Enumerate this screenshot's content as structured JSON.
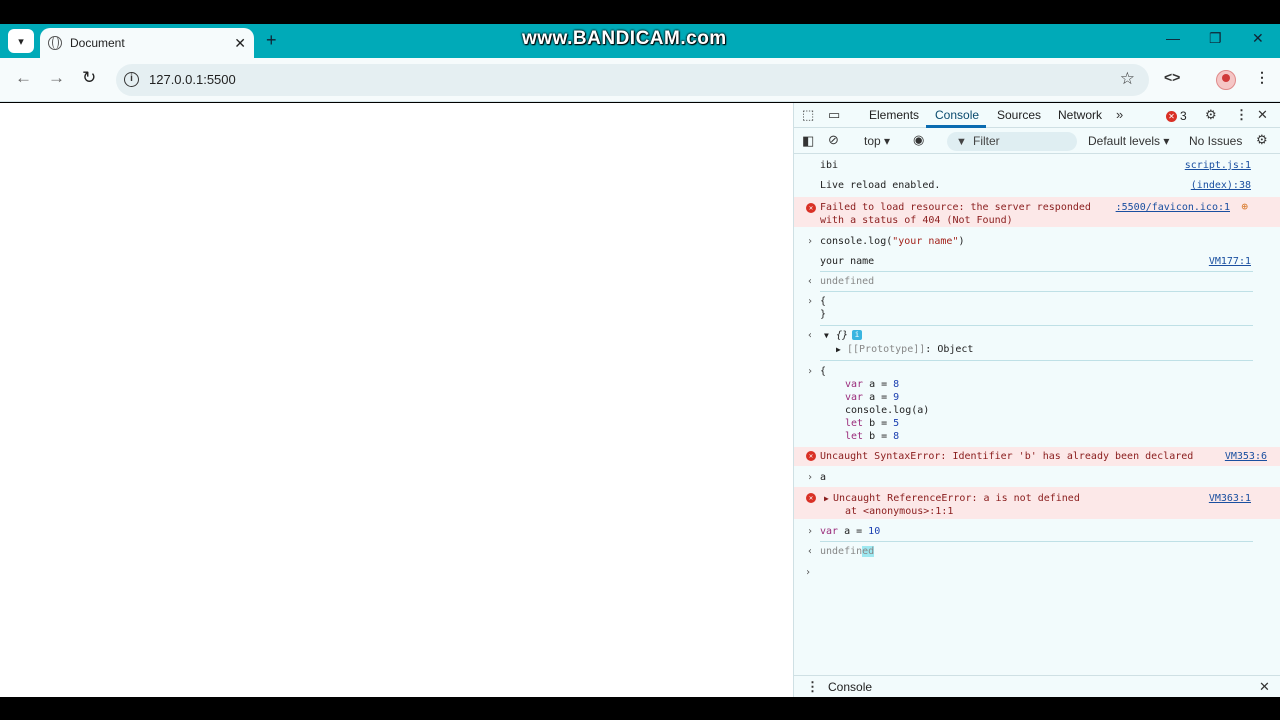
{
  "browser": {
    "tab_title": "Document",
    "new_tab": "+",
    "watermark": "www.BANDICAM.com",
    "url": "127.0.0.1:5500"
  },
  "devtools": {
    "tabs": [
      "Elements",
      "Console",
      "Sources",
      "Network"
    ],
    "error_count": "3",
    "context": "top",
    "filter_placeholder": "Filter",
    "levels": "Default levels",
    "issues": "No Issues",
    "drawer_label": "Console"
  },
  "console": {
    "log_ibi": {
      "text": "ibi",
      "source": "script.js:1"
    },
    "log_reload": {
      "text": "Live reload enabled.",
      "source": "(index):38"
    },
    "error_404": {
      "line1": "Failed to load resource: the server responded",
      "line2": "with a status of 404 (Not Found)",
      "source": ":5500/favicon.ico:1"
    },
    "input_log": {
      "prefix": "console.log(",
      "string": "\"your name\"",
      "suffix": ")"
    },
    "output_name": {
      "text": "your name",
      "source": "VM177:1"
    },
    "result_undefined_1": "undefined",
    "input_obj": {
      "line1": "{",
      "line2": "}"
    },
    "result_obj": {
      "label": "{}",
      "proto_key": "[[Prototype]]",
      "proto_val": ": Object"
    },
    "input_block": {
      "open": "{",
      "l1_kw": "var",
      "l1_rest": " a = ",
      "l1_num": "8",
      "l2_kw": "var",
      "l2_rest": " a = ",
      "l2_num": "9",
      "l3": "console.log(a)",
      "l4_kw": "let",
      "l4_rest": " b = ",
      "l4_num": "5",
      "l5_kw": "let",
      "l5_rest": " b = ",
      "l5_num": "8"
    },
    "syntax_error": {
      "text": "Uncaught SyntaxError: Identifier 'b' has already been declared",
      "source": "VM353:6"
    },
    "input_a": "a",
    "ref_error": {
      "line1": "Uncaught ReferenceError: a is not defined",
      "line2": "at <anonymous>:1:1",
      "source": "VM363:1"
    },
    "input_var": {
      "kw": "var",
      "rest": " a = ",
      "num": "10"
    },
    "result_undefined_2a": "undefin",
    "result_undefined_2b": "ed"
  }
}
